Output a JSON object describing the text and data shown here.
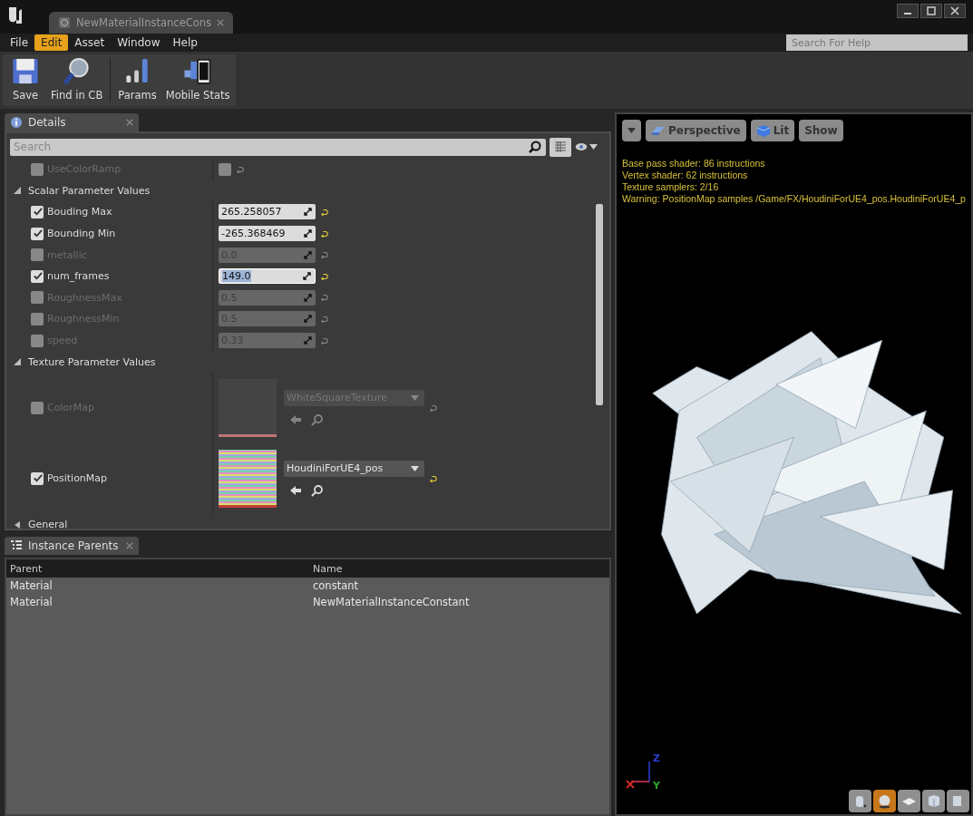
{
  "window": {
    "tab_title": "NewMaterialInstanceCons",
    "menu": [
      {
        "label": "File",
        "selected": false
      },
      {
        "label": "Edit",
        "selected": true
      },
      {
        "label": "Asset",
        "selected": false
      },
      {
        "label": "Window",
        "selected": false
      },
      {
        "label": "Help",
        "selected": false
      }
    ],
    "help_search": {
      "placeholder": "Search For Help"
    }
  },
  "toolbar": [
    {
      "kind": "save",
      "label": "Save"
    },
    {
      "kind": "find",
      "label": "Find in CB"
    },
    {
      "kind": "params",
      "label": "Params"
    },
    {
      "kind": "mobile",
      "label": "Mobile Stats"
    }
  ],
  "details": {
    "tab": "Details",
    "search": {
      "placeholder": "Search"
    },
    "items": [
      {
        "kind": "switch",
        "name": "UseColorRamp",
        "checked": false,
        "value_checked": false
      },
      {
        "kind": "section",
        "label": "Scalar Parameter Values",
        "expanded": true
      },
      {
        "kind": "scalar",
        "name": "Bouding Max",
        "checked": true,
        "value": "265.258057",
        "focused": false
      },
      {
        "kind": "scalar",
        "name": "Bounding Min",
        "checked": true,
        "value": "-265.368469",
        "focused": false
      },
      {
        "kind": "scalar",
        "name": "metallic",
        "checked": false,
        "value": "0.0",
        "focused": false
      },
      {
        "kind": "scalar",
        "name": "num_frames",
        "checked": true,
        "value": "149.0",
        "focused": true
      },
      {
        "kind": "scalar",
        "name": "RoughnessMax",
        "checked": false,
        "value": "0.5",
        "focused": false
      },
      {
        "kind": "scalar",
        "name": "RoughnessMin",
        "checked": false,
        "value": "0.5",
        "focused": false
      },
      {
        "kind": "scalar",
        "name": "speed",
        "checked": false,
        "value": "0.33",
        "focused": false
      },
      {
        "kind": "section",
        "label": "Texture Parameter Values",
        "expanded": true
      },
      {
        "kind": "texture",
        "name": "ColorMap",
        "checked": false,
        "asset": "WhiteSquareTexture"
      },
      {
        "kind": "texture",
        "name": "PositionMap",
        "checked": true,
        "asset": "HoudiniForUE4_pos"
      },
      {
        "kind": "section",
        "label": "General",
        "expanded": false
      }
    ]
  },
  "instance_parents": {
    "tab": "Instance Parents",
    "columns": [
      "Parent",
      "Name"
    ],
    "rows": [
      [
        "Material",
        "constant"
      ],
      [
        "Material",
        "NewMaterialInstanceConstant"
      ]
    ]
  },
  "viewport": {
    "buttons": [
      {
        "kind": "menu"
      },
      {
        "kind": "perspective",
        "label": "Perspective"
      },
      {
        "kind": "lit",
        "label": "Lit"
      },
      {
        "kind": "plain",
        "label": "Show"
      }
    ],
    "stats": [
      "Base pass shader: 86 instructions",
      "Vertex shader: 62 instructions",
      "Texture samplers: 2/16",
      "Warning: PositionMap samples /Game/FX/HoudiniForUE4_pos.HoudiniForUE4_p"
    ],
    "axes": {
      "z": "Z",
      "y": "Y"
    },
    "preview_shapes": [
      {
        "kind": "cylinder",
        "selected": false
      },
      {
        "kind": "sphere",
        "selected": true
      },
      {
        "kind": "plane",
        "selected": false
      },
      {
        "kind": "cube",
        "selected": false
      },
      {
        "kind": "mesh",
        "selected": false
      }
    ]
  }
}
